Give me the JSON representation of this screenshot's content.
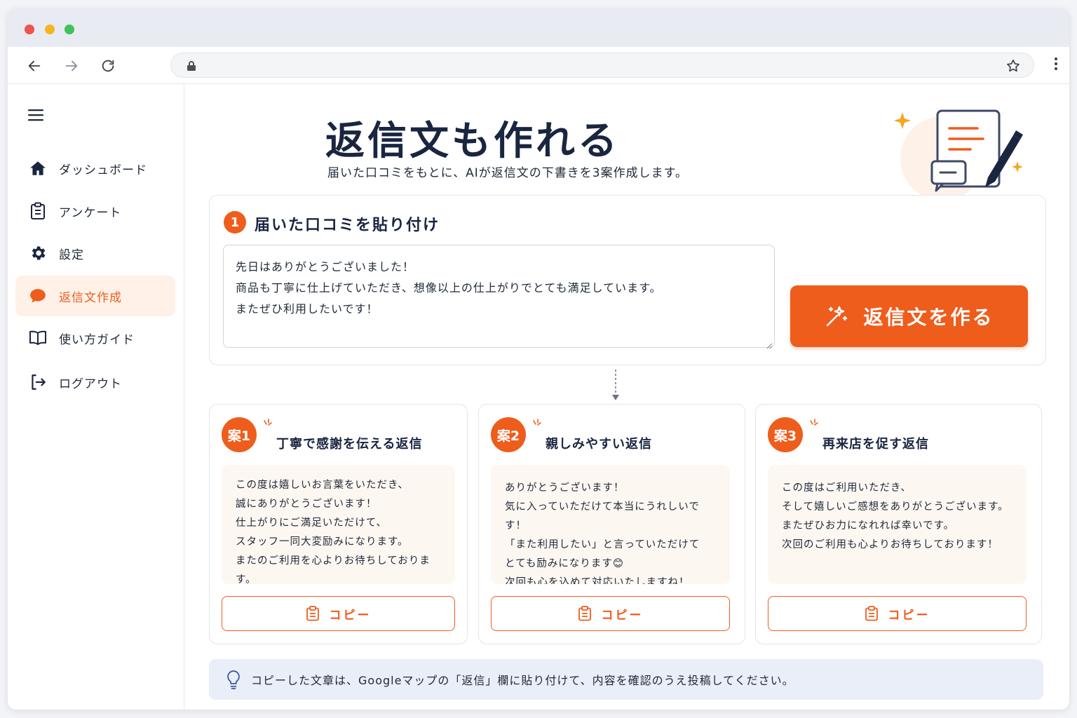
{
  "browser": {
    "url": ""
  },
  "sidebar": {
    "items": [
      {
        "label": "ダッシュボード",
        "icon": "home-icon"
      },
      {
        "label": "アンケート",
        "icon": "clipboard-icon"
      },
      {
        "label": "設定",
        "icon": "gear-icon"
      },
      {
        "label": "返信文作成",
        "icon": "chat-bubble-icon",
        "active": true
      },
      {
        "label": "使い方ガイド",
        "icon": "book-icon"
      },
      {
        "label": "ログアウト",
        "icon": "logout-icon"
      }
    ]
  },
  "header": {
    "title": "返信文も作れる",
    "subtitle": "届いた口コミをもとに、AIが返信文の下書きを3案作成します。"
  },
  "input_section": {
    "step": "1",
    "title": "届いた口コミを貼り付け",
    "review_text": "先日はありがとうございました！\n商品も丁寧に仕上げていただき、想像以上の仕上がりでとても満足しています。\nまたぜひ利用したいです！",
    "generate_label": "返信文を作る"
  },
  "plans": [
    {
      "badge": "案1",
      "title": "丁寧で感謝を伝える返信",
      "text": "この度は嬉しいお言葉をいただき、\n誠にありがとうございます！\n仕上がりにご満足いただけて、\nスタッフ一同大変励みになります。\nまたのご利用を心よりお待ちしております。",
      "copy_label": "コピー"
    },
    {
      "badge": "案2",
      "title": "親しみやすい返信",
      "text": "ありがとうございます！\n気に入っていただけて本当にうれしいです！\n「また利用したい」と言っていただけて\nとても励みになります😊\n次回も心を込めて対応いたしますね！",
      "copy_label": "コピー"
    },
    {
      "badge": "案3",
      "title": "再来店を促す返信",
      "text": "この度はご利用いただき、\nそして嬉しいご感想をありがとうございます。\nまたぜひお力になれれば幸いです。\n次回のご利用も心よりお待ちしております！",
      "copy_label": "コピー"
    }
  ],
  "tip": {
    "text": "コピーした文章は、Googleマップの「返信」欄に貼り付けて、内容を確認のうえ投稿してください。"
  },
  "colors": {
    "accent": "#ee5d1c",
    "accent_light": "#fff1e8",
    "title": "#1a2540",
    "tip_bg": "#e9eef8"
  }
}
